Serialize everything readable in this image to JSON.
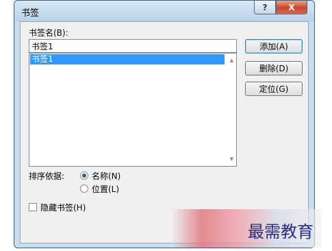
{
  "window": {
    "title": "书签",
    "help_label": "?",
    "close_label": "X"
  },
  "bookmark_name": {
    "label": "书签名(B):",
    "value": "书签1"
  },
  "bookmark_list": {
    "items": [
      "书签1"
    ],
    "selected_index": 0
  },
  "buttons": {
    "add": "添加(A)",
    "delete": "删除(D)",
    "goto": "定位(G)"
  },
  "sort": {
    "label": "排序依据:",
    "options": [
      "名称(N)",
      "位置(L)"
    ],
    "selected": 0
  },
  "hidden_bookmarks": {
    "label": "隐藏书签(H)",
    "checked": false
  },
  "watermark": {
    "text": "最需教育"
  },
  "colors": {
    "selection": "#3399ff",
    "dialog_bg": "#f0f0f0",
    "frame": "#c8dcec"
  }
}
